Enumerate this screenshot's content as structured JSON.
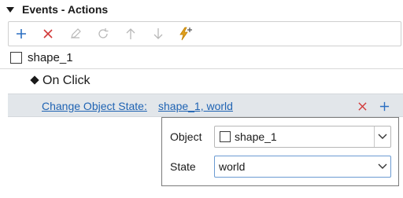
{
  "panel": {
    "title": "Events - Actions"
  },
  "toolbar": {
    "buttons": [
      {
        "icon": "plus-icon",
        "label": "Add",
        "color": "#2b6fc2",
        "enabled": true
      },
      {
        "icon": "close-icon",
        "label": "Delete",
        "color": "#d23a3a",
        "enabled": true
      },
      {
        "icon": "pencil-icon",
        "label": "Edit",
        "color": "#b8b8b8",
        "enabled": false
      },
      {
        "icon": "refresh-icon",
        "label": "Refresh",
        "color": "#b8b8b8",
        "enabled": false
      },
      {
        "icon": "arrow-up-icon",
        "label": "Move up",
        "color": "#b8b8b8",
        "enabled": false
      },
      {
        "icon": "arrow-down-icon",
        "label": "Move down",
        "color": "#b8b8b8",
        "enabled": false
      },
      {
        "icon": "lightning-plus-icon",
        "label": "Add event",
        "color": "#e0a020",
        "enabled": true
      }
    ]
  },
  "tree": {
    "object": {
      "label": "shape_1",
      "checked": false
    },
    "event": {
      "label": "On Click"
    },
    "action": {
      "name": "Change Object State:",
      "params": "shape_1, world"
    }
  },
  "editor": {
    "object_label": "Object",
    "object_value": "shape_1",
    "state_label": "State",
    "state_value": "world"
  },
  "colors": {
    "link": "#1f63b3",
    "delete": "#d23a3a",
    "add": "#2b6fc2",
    "selection": "#e2e6ea"
  }
}
